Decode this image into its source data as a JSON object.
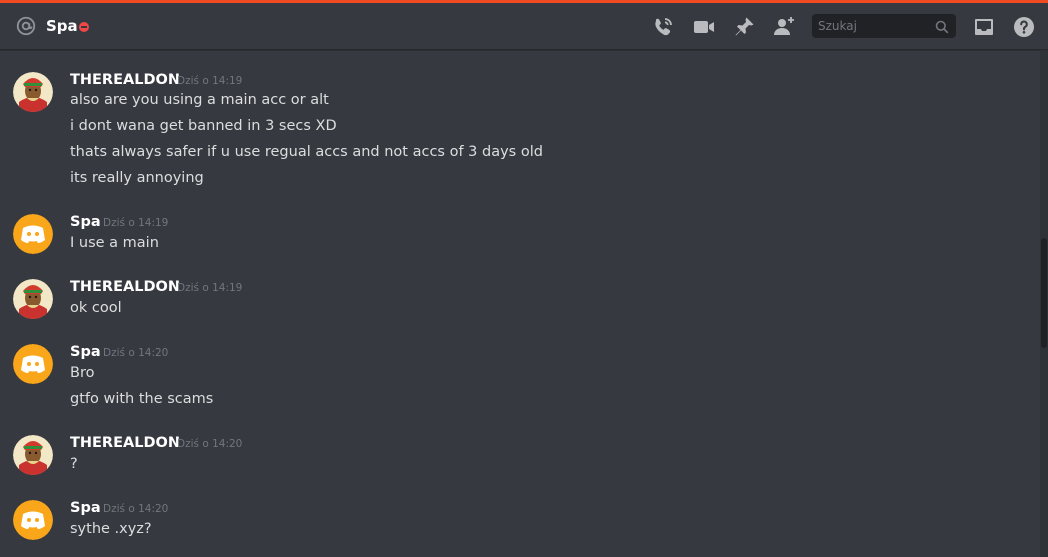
{
  "header": {
    "recipient": "Spa",
    "status": "dnd",
    "search_placeholder": "Szukaj",
    "icons": [
      "at-sign-icon",
      "voice-call-icon",
      "video-call-icon",
      "pin-icon",
      "add-friend-icon",
      "search-icon",
      "inbox-icon",
      "help-icon"
    ]
  },
  "colors": {
    "background": "#36393f",
    "accent_top": "#f04a23",
    "dnd": "#f04747",
    "discord_avatar": "#faa61a"
  },
  "messages": [
    {
      "author": "THEREALDON",
      "timestamp": "Dziś o 14:19",
      "avatar": "custom-avatar",
      "lines": [
        "also are you using a main acc or alt",
        "i dont wana get banned in 3 secs XD",
        "thats always safer if u use regual accs and not accs of 3 days old",
        "its really annoying"
      ]
    },
    {
      "author": "Spa",
      "timestamp": "Dziś o 14:19",
      "avatar": "default-discord-avatar",
      "lines": [
        "I use a main"
      ]
    },
    {
      "author": "THEREALDON",
      "timestamp": "Dziś o 14:19",
      "avatar": "custom-avatar",
      "lines": [
        "ok cool"
      ]
    },
    {
      "author": "Spa",
      "timestamp": "Dziś o 14:20",
      "avatar": "default-discord-avatar",
      "lines": [
        "Bro",
        "gtfo with the scams"
      ]
    },
    {
      "author": "THEREALDON",
      "timestamp": "Dziś o 14:20",
      "avatar": "custom-avatar",
      "lines": [
        "?"
      ]
    },
    {
      "author": "Spa",
      "timestamp": "Dziś o 14:20",
      "avatar": "default-discord-avatar",
      "lines": [
        "sythe .xyz?"
      ]
    }
  ]
}
